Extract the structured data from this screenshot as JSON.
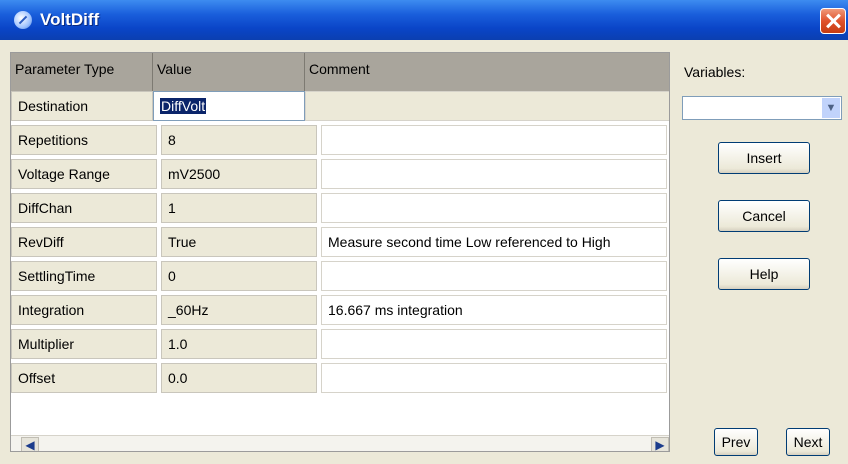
{
  "window": {
    "title": "VoltDiff"
  },
  "grid": {
    "headers": [
      "Parameter Type",
      "Value",
      "Comment"
    ],
    "rows": [
      {
        "name": "Destination",
        "value": "DiffVolt",
        "comment": ""
      },
      {
        "name": "Repetitions",
        "value": "8",
        "comment": ""
      },
      {
        "name": "Voltage Range",
        "value": "mV2500",
        "comment": ""
      },
      {
        "name": "DiffChan",
        "value": "1",
        "comment": ""
      },
      {
        "name": "RevDiff",
        "value": "True",
        "comment": "Measure second time Low referenced to High"
      },
      {
        "name": "SettlingTime",
        "value": "0",
        "comment": ""
      },
      {
        "name": "Integration",
        "value": "_60Hz",
        "comment": "16.667 ms integration"
      },
      {
        "name": "Multiplier",
        "value": "1.0",
        "comment": ""
      },
      {
        "name": "Offset",
        "value": "0.0",
        "comment": ""
      }
    ]
  },
  "side": {
    "variables_label": "Variables:",
    "variables_value": "",
    "insert": "Insert",
    "cancel": "Cancel",
    "help": "Help",
    "prev": "Prev",
    "next": "Next"
  },
  "icons": {
    "app": "voltdiff-app-icon",
    "close": "close-icon",
    "dropdown": "chevron-down-icon",
    "scroll_left": "arrow-left-icon",
    "scroll_right": "arrow-right-icon"
  }
}
